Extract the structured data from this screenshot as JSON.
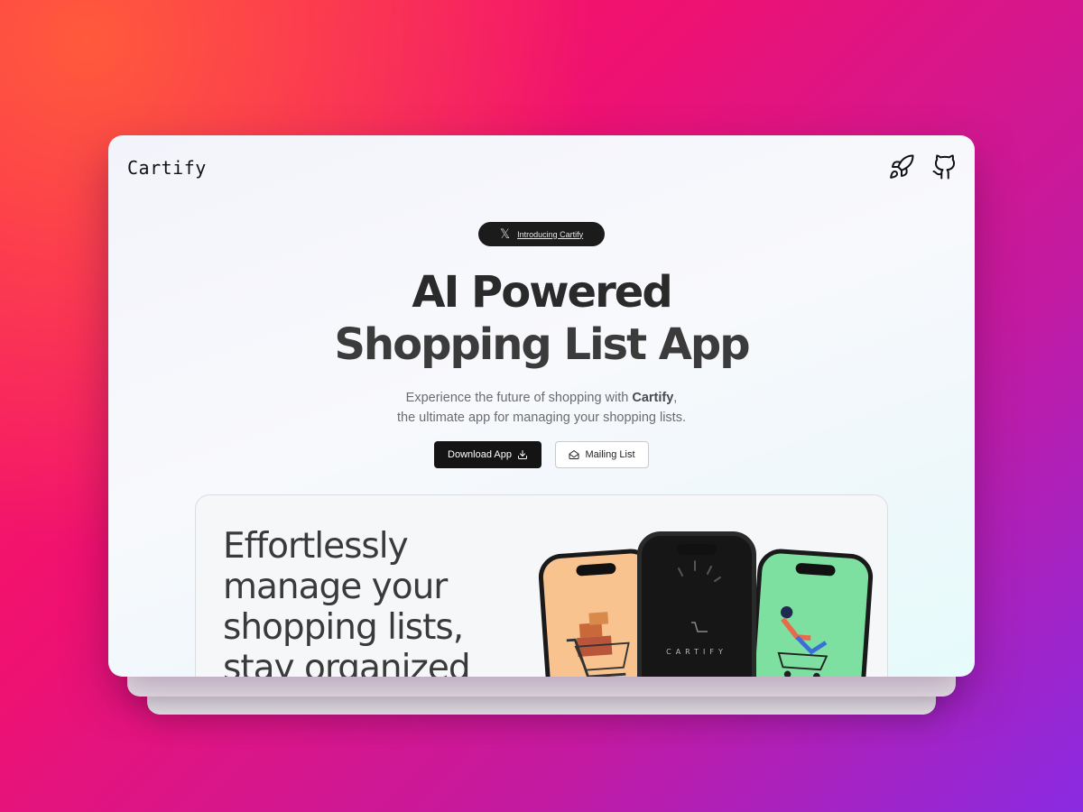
{
  "app": {
    "logo": "Cartify"
  },
  "header": {
    "icons": [
      "rocket-icon",
      "github-icon"
    ]
  },
  "announcement": {
    "icon": "x-logo-icon",
    "label": "Introducing Cartify"
  },
  "hero": {
    "title_line1": "AI Powered",
    "title_line2": "Shopping List App",
    "subtitle_prefix": "Experience the future of shopping with ",
    "subtitle_brand": "Cartify",
    "subtitle_suffix": ",",
    "subtitle_line2": "the ultimate app for managing your shopping lists."
  },
  "buttons": {
    "download_label": "Download App",
    "mailing_label": "Mailing List"
  },
  "feature": {
    "text": "Effortlessly manage your shopping lists, stay organized",
    "phone_brand": "CARTIFY"
  },
  "colors": {
    "background_start": "#ff1f5a",
    "background_end": "#8a2be2",
    "primary_button": "#141414",
    "phone_left": "#f9c38f",
    "phone_right": "#7ee0a0"
  }
}
